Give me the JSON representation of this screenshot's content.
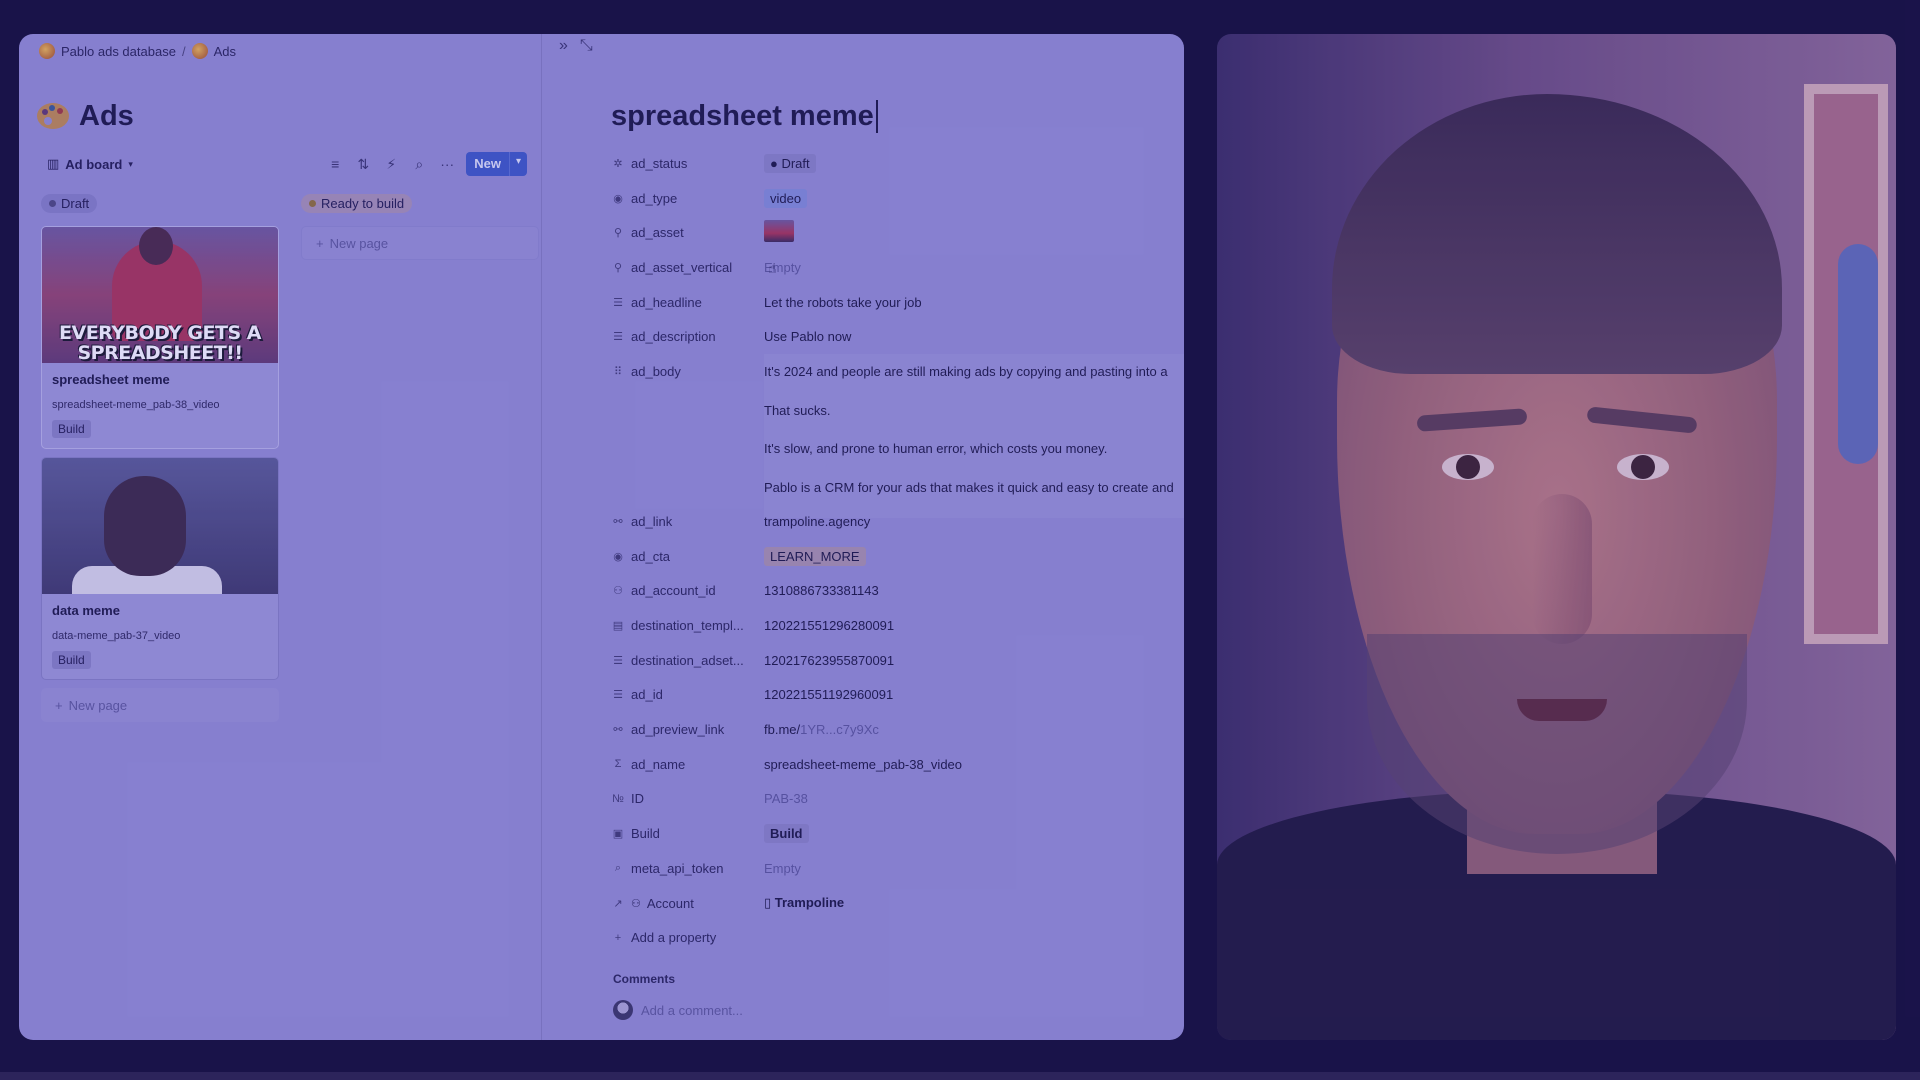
{
  "breadcrumb": {
    "database": "Pablo ads database",
    "separator": "/",
    "page": "Ads"
  },
  "top_icons": {
    "collapse": "»",
    "expand": "⤡"
  },
  "page_title": "Ads",
  "view": {
    "name": "Ad board",
    "new_label": "New"
  },
  "columns": [
    {
      "status": "Draft",
      "cards": [
        {
          "title": "spreadsheet meme",
          "subtitle": "spreadsheet-meme_pab-38_video",
          "tag": "Build",
          "meme_text": "EVERYBODY GETS A SPREADSHEET!!"
        },
        {
          "title": "data meme",
          "subtitle": "data-meme_pab-37_video",
          "tag": "Build"
        }
      ],
      "new_page": "New page"
    },
    {
      "status": "Ready to build",
      "cards": [],
      "new_page": "New page"
    }
  ],
  "detail": {
    "title": "spreadsheet meme",
    "properties": {
      "ad_status": {
        "name": "ad_status",
        "value": "Draft"
      },
      "ad_type": {
        "name": "ad_type",
        "value": "video"
      },
      "ad_asset": {
        "name": "ad_asset"
      },
      "ad_asset_vertical": {
        "name": "ad_asset_vertical",
        "value": "Empty"
      },
      "ad_headline": {
        "name": "ad_headline",
        "value": "Let the robots take your job"
      },
      "ad_description": {
        "name": "ad_description",
        "value": "Use Pablo now"
      },
      "ad_body": {
        "name": "ad_body",
        "lines": [
          "It's 2024 and people are still making ads by copying and pasting into a",
          "That sucks.",
          "It's slow, and prone to human error, which costs you money.",
          "Pablo is a CRM for your ads that makes it quick and easy to create and"
        ]
      },
      "ad_link": {
        "name": "ad_link",
        "value": "trampoline.agency"
      },
      "ad_cta": {
        "name": "ad_cta",
        "value": "LEARN_MORE"
      },
      "ad_account_id": {
        "name": "ad_account_id",
        "value": "1310886733381143"
      },
      "destination_template": {
        "name": "destination_templ...",
        "value": "120221551296280091"
      },
      "destination_adset": {
        "name": "destination_adset...",
        "value": "120217623955870091"
      },
      "ad_id": {
        "name": "ad_id",
        "value": "120221551192960091"
      },
      "ad_preview_link": {
        "name": "ad_preview_link",
        "value_prefix": "fb.me/",
        "value_rest": "1YR...c7y9Xc"
      },
      "ad_name": {
        "name": "ad_name",
        "value": "spreadsheet-meme_pab-38_video"
      },
      "id": {
        "name": "ID",
        "value": "PAB-38"
      },
      "build": {
        "name": "Build",
        "value": "Build"
      },
      "meta_api_token": {
        "name": "meta_api_token",
        "value": "Empty"
      },
      "account": {
        "name": "Account",
        "value": "Trampoline"
      }
    },
    "add_property": "Add a property",
    "comments_label": "Comments",
    "comment_placeholder": "Add a comment..."
  }
}
